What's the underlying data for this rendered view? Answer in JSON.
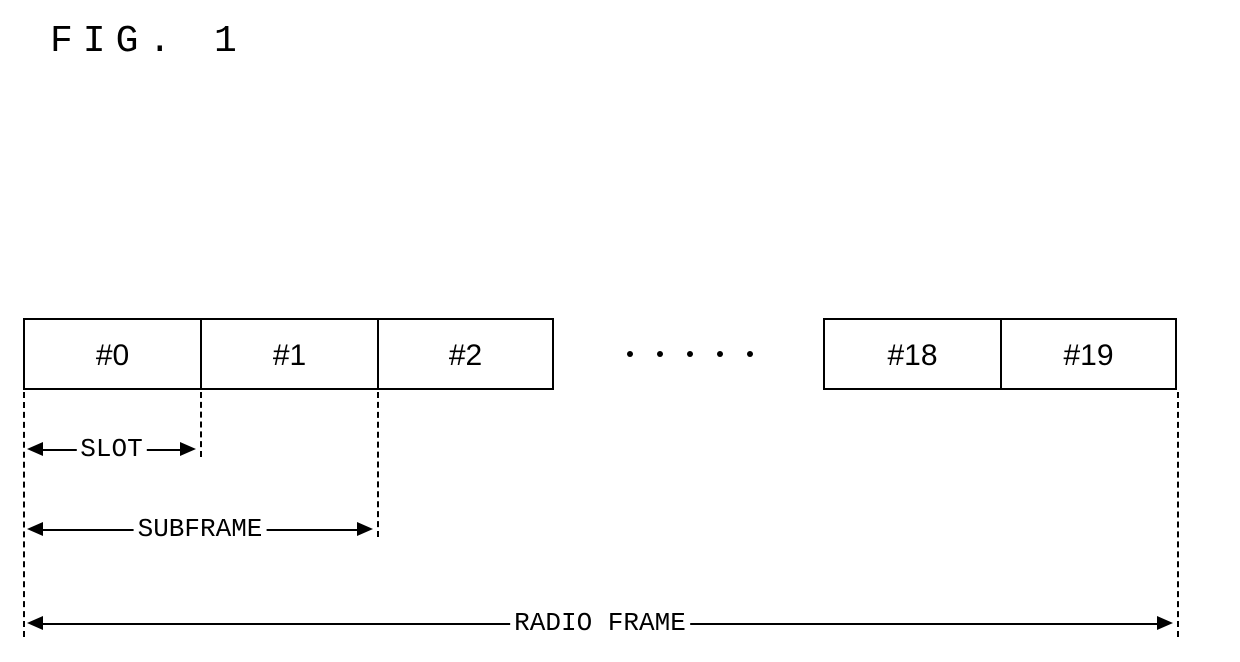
{
  "title": "FIG. 1",
  "slots": {
    "s0": "#0",
    "s1": "#1",
    "s2": "#2",
    "s18": "#18",
    "s19": "#19"
  },
  "labels": {
    "slot": "SLOT",
    "subframe": "SUBFRAME",
    "radioframe": "RADIO FRAME"
  }
}
